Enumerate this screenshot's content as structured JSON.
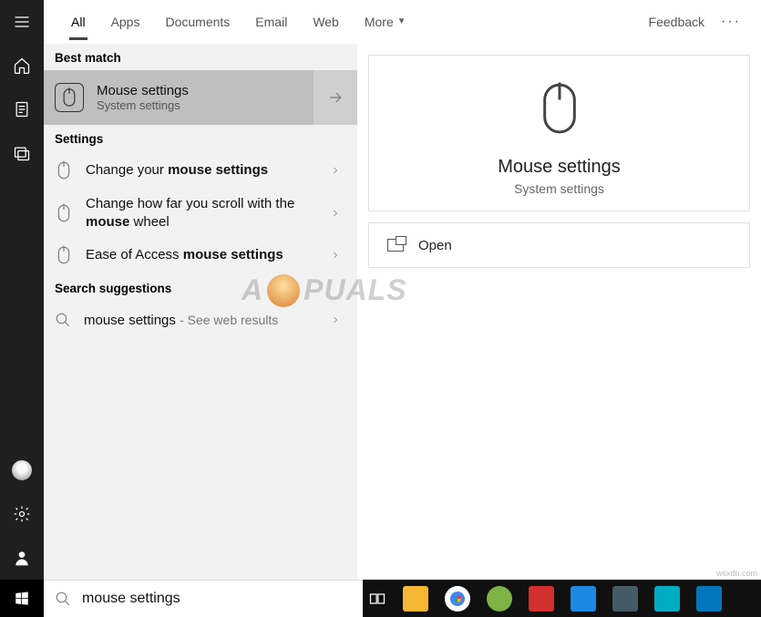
{
  "header": {
    "tabs": [
      "All",
      "Apps",
      "Documents",
      "Email",
      "Web",
      "More"
    ],
    "active_tab": 0,
    "feedback": "Feedback"
  },
  "sections": {
    "best_match_header": "Best match",
    "settings_header": "Settings",
    "suggestions_header": "Search suggestions"
  },
  "best_match": {
    "title": "Mouse settings",
    "subtitle": "System settings"
  },
  "settings_results": [
    {
      "prefix": "Change your ",
      "bold": "mouse settings",
      "suffix": ""
    },
    {
      "prefix": "Change how far you scroll with the ",
      "bold": "mouse",
      "suffix": " wheel"
    },
    {
      "prefix": "Ease of Access ",
      "bold": "mouse settings",
      "suffix": ""
    }
  ],
  "suggestion": {
    "query": "mouse settings",
    "hint": "See web results"
  },
  "detail": {
    "title": "Mouse settings",
    "subtitle": "System settings",
    "open_label": "Open"
  },
  "search": {
    "value": "mouse settings"
  },
  "watermark": "A   PUALS",
  "attribution": "wsxdn.com",
  "taskbar_colors": [
    "#f7b733",
    "#4285f4",
    "#7cb342",
    "#d32f2f",
    "#1e88e5",
    "#455a64",
    "#00acc1",
    "#0277bd"
  ]
}
